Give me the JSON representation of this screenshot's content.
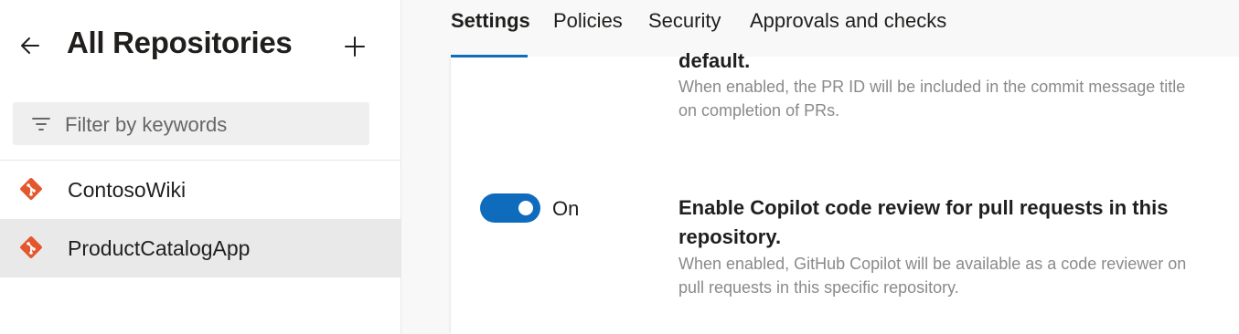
{
  "sidebar": {
    "title": "All Repositories",
    "back_icon": "arrow-left-icon",
    "add_icon": "plus-icon",
    "filter": {
      "placeholder": "Filter by keywords",
      "icon": "filter-icon"
    },
    "repos": [
      {
        "label": "ContosoWiki",
        "icon": "git-repo-icon",
        "selected": false
      },
      {
        "label": "ProductCatalogApp",
        "icon": "git-repo-icon",
        "selected": true
      }
    ]
  },
  "tabs": [
    {
      "label": "Settings",
      "active": true
    },
    {
      "label": "Policies",
      "active": false
    },
    {
      "label": "Security",
      "active": false
    },
    {
      "label": "Approvals and checks",
      "active": false
    }
  ],
  "settings": {
    "prev_title_fragment": "default.",
    "prev_description_line1": "When enabled, the PR ID will be included in the commit message title",
    "prev_description_line2": "on completion of PRs.",
    "copilot": {
      "toggle_state": "On",
      "title_line1": "Enable Copilot code review for pull requests in this",
      "title_line2": "repository.",
      "description_line1": "When enabled, GitHub Copilot will be available as a code reviewer on",
      "description_line2": "pull requests in this specific repository."
    }
  },
  "colors": {
    "accent": "#0f6cbd",
    "git_icon": "#e4572e"
  }
}
